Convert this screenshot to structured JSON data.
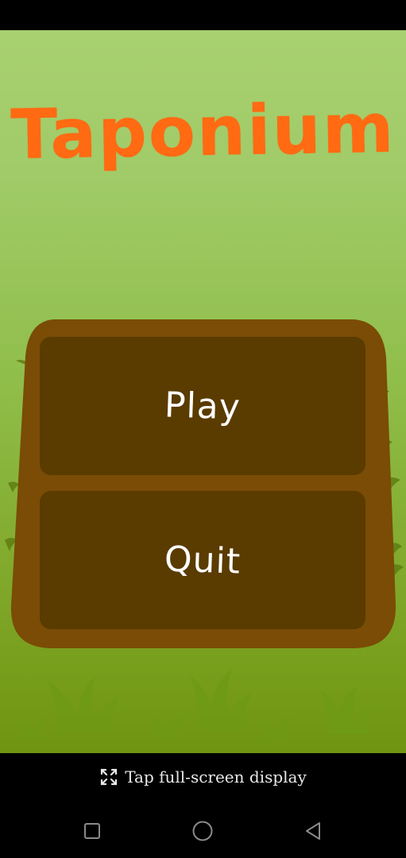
{
  "game": {
    "title": "Taponium",
    "title_color": "#ff6a12",
    "menu": {
      "play_label": "Play",
      "quit_label": "Quit"
    },
    "colors": {
      "board": "#7a4c05",
      "button": "#5a3b00",
      "sky_top": "#a8d070",
      "ground": "#6f9410"
    }
  },
  "system": {
    "fullscreen_hint": "Tap full-screen display",
    "fullscreen_icon": "expand-arrows-icon",
    "nav": {
      "recents_icon": "square-icon",
      "home_icon": "circle-icon",
      "back_icon": "triangle-back-icon"
    }
  }
}
